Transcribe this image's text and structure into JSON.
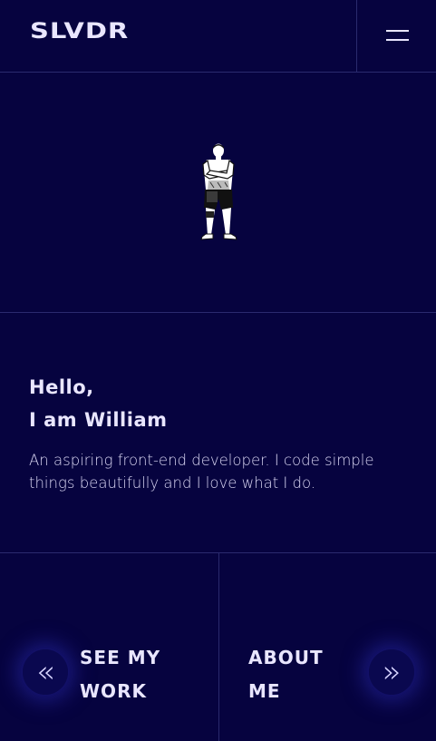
{
  "header": {
    "logo": "SLVDR",
    "menu_icon": "hamburger-icon"
  },
  "hero": {
    "image": "person-standing-illustration"
  },
  "intro": {
    "greeting_line1": "Hello,",
    "greeting_line2": "I am William",
    "description": "An aspiring front-end developer. I code simple things beautifully and I love what I do."
  },
  "nav": {
    "left": {
      "arrow": "«",
      "label_line1": "SEE MY",
      "label_line2": "WORK",
      "icon": "double-chevron-left-icon"
    },
    "right": {
      "arrow": "»",
      "label_line1": "ABOUT",
      "label_line2": "ME",
      "icon": "double-chevron-right-icon"
    }
  },
  "colors": {
    "background": "#06033f",
    "border": "#2a2a6e",
    "text": "#e9e6ff"
  }
}
